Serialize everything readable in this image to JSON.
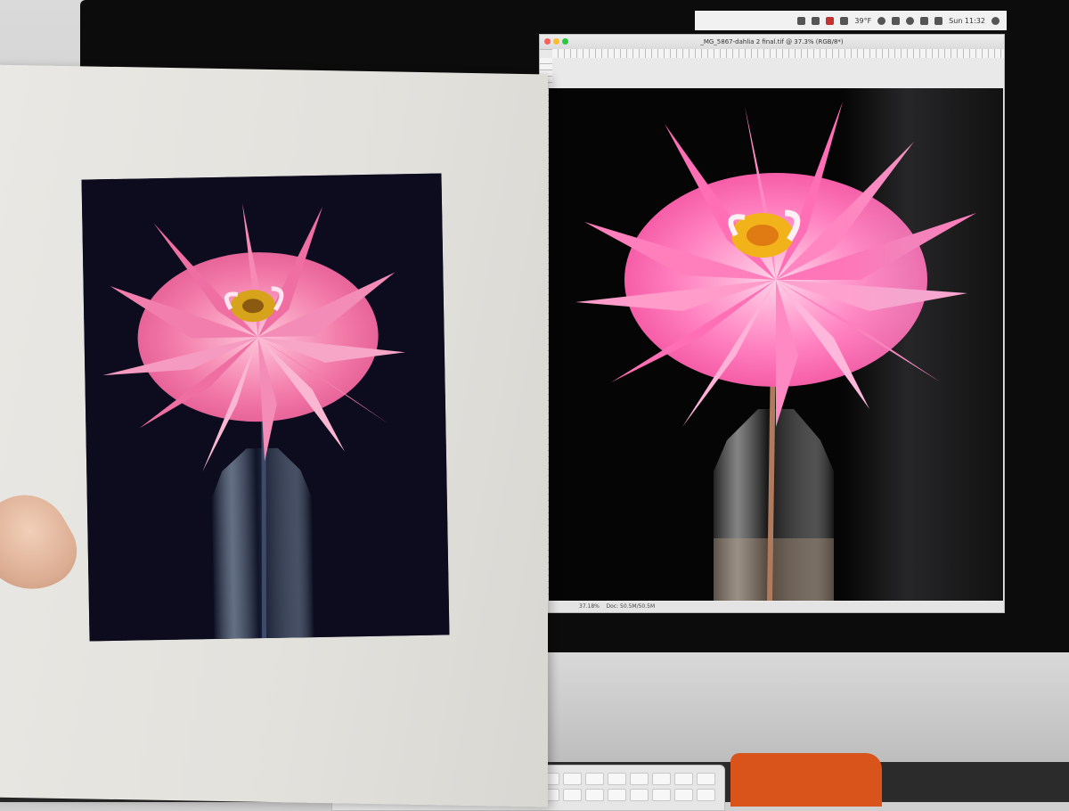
{
  "menubar": {
    "weather": "39°F",
    "clock": "Sun 11:32",
    "icons": [
      "dropbox-icon",
      "cloud-icon",
      "flag-icon",
      "printer-icon",
      "time-machine-icon",
      "bluetooth-icon",
      "wifi-icon",
      "airplay-icon",
      "battery-icon",
      "user-icon"
    ]
  },
  "photoshop": {
    "title": "_MG_5867-dahlia 2 final.tif @ 37.3% (RGB/8*)",
    "zoom": "37.18%",
    "doc_size": "Doc: 50.5M/50.5M"
  },
  "scene": {
    "subject": "pink-dahlia-in-glass-bottle",
    "colors": {
      "petal": "#f06aa6",
      "petal_light": "#ffc3e0",
      "center": "#f2b21a",
      "background": "#050505",
      "mat": "#e6e4df",
      "chassis": "#cfcfcf"
    }
  }
}
